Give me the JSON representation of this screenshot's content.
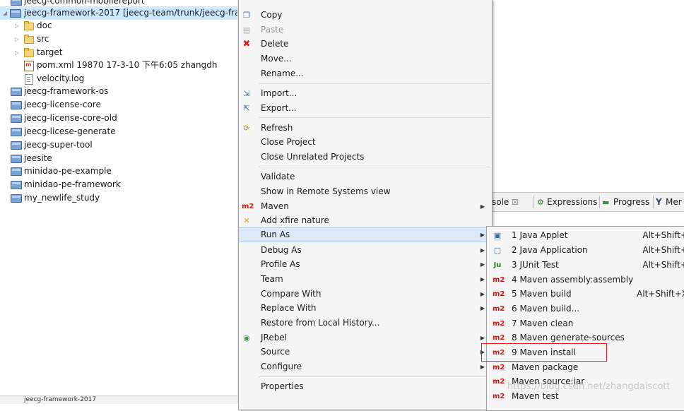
{
  "tree": {
    "top_partial": "jeecg-common-mobilereport",
    "project_label": "jeecg-framework-2017 [jeecg-team/trunk/jeecg-framew",
    "children": [
      {
        "label": "doc",
        "icon": "folder-icon"
      },
      {
        "label": "src",
        "icon": "source-folder-icon"
      },
      {
        "label": "target",
        "icon": "folder-icon"
      },
      {
        "label": "pom.xml 19870  17-3-10 下午6:05  zhangdh",
        "icon": "pom-file-icon"
      },
      {
        "label": "velocity.log",
        "icon": "file-icon"
      }
    ],
    "projects": [
      "jeecg-framework-os",
      "jeecg-license-core",
      "jeecg-license-core-old",
      "jeecg-licese-generate",
      "jeecg-super-tool",
      "jeesite",
      "minidao-pe-example",
      "minidao-pe-framework",
      "my_newlife_study"
    ],
    "bottom_partial": "jeecg-framework-2017"
  },
  "menu": {
    "items": [
      {
        "label": "Copy",
        "icon": "copy-icon"
      },
      {
        "label": "Paste",
        "icon": "paste-icon",
        "disabled": true
      },
      {
        "label": "Delete",
        "icon": "delete-icon"
      },
      {
        "label": "Move..."
      },
      {
        "label": "Rename..."
      },
      {
        "label": "Import...",
        "icon": "import-icon"
      },
      {
        "label": "Export...",
        "icon": "export-icon"
      },
      {
        "label": "Refresh",
        "icon": "refresh-icon"
      },
      {
        "label": "Close Project"
      },
      {
        "label": "Close Unrelated Projects"
      },
      {
        "label": "Validate"
      },
      {
        "label": "Show in Remote Systems view"
      },
      {
        "label": "Maven",
        "icon": "m2",
        "submenu": true
      },
      {
        "label": "Add xfire nature",
        "icon": "xfire-icon"
      },
      {
        "label": "Run As",
        "submenu": true
      },
      {
        "label": "Debug As",
        "submenu": true
      },
      {
        "label": "Profile As",
        "submenu": true
      },
      {
        "label": "Team",
        "submenu": true
      },
      {
        "label": "Compare With",
        "submenu": true
      },
      {
        "label": "Replace With",
        "submenu": true
      },
      {
        "label": "Restore from Local History..."
      },
      {
        "label": "JRebel",
        "icon": "jrebel-icon",
        "submenu": true
      },
      {
        "label": "Source",
        "submenu": true
      },
      {
        "label": "Configure",
        "submenu": true
      },
      {
        "label": "Properties"
      }
    ],
    "m2_text": "m2",
    "submenu_arrow": "▶"
  },
  "submenu": {
    "items": [
      {
        "label": "1 Java Applet",
        "accel": "Alt+Shift+",
        "icon": "java-applet-icon"
      },
      {
        "label": "2 Java Application",
        "accel": "Alt+Shift+",
        "icon": "java-app-icon"
      },
      {
        "label": "3 JUnit Test",
        "accel": "Alt+Shift+",
        "icon": "junit-icon"
      },
      {
        "label": "4 Maven assembly:assembly",
        "icon": "m2"
      },
      {
        "label": "5 Maven build",
        "accel": "Alt+Shift+X",
        "icon": "m2"
      },
      {
        "label": "6 Maven build...",
        "icon": "m2"
      },
      {
        "label": "7 Maven clean",
        "icon": "m2"
      },
      {
        "label": "8 Maven generate-sources",
        "icon": "m2"
      },
      {
        "label": "9 Maven install",
        "icon": "m2"
      },
      {
        "label": "Maven package",
        "icon": "m2"
      },
      {
        "label": "Maven source:jar",
        "icon": "m2"
      },
      {
        "label": "Maven test",
        "icon": "m2"
      }
    ],
    "junit_text": "Ju"
  },
  "tabs": {
    "console": "sole",
    "console_close": "☒",
    "expressions": "Expressions",
    "progress": "Progress",
    "memory": "Mer"
  },
  "watermark": "https://blog.csdn.net/zhangdaiscott"
}
